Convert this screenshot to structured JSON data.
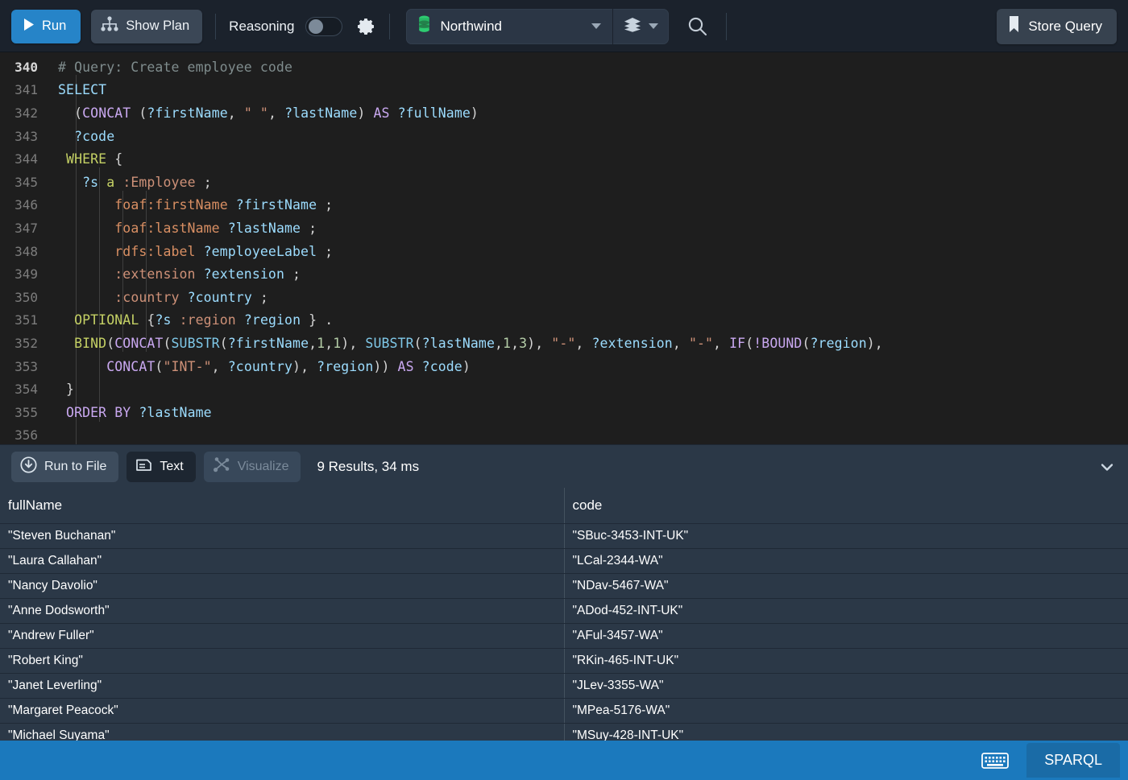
{
  "toolbar": {
    "run_label": "Run",
    "show_plan_label": "Show Plan",
    "reasoning_label": "Reasoning",
    "reasoning_enabled": false,
    "database_name": "Northwind",
    "store_query_label": "Store Query",
    "icons": {
      "run": "play-icon",
      "show_plan": "plan-tree-icon",
      "settings": "gear-icon",
      "database": "database-cylinder-icon",
      "layers": "layers-icon",
      "search": "search-icon",
      "store_query": "bookmark-icon"
    },
    "accent_color": "#2684c8"
  },
  "editor": {
    "language": "SPARQL",
    "first_line_number": 340,
    "lines": [
      {
        "n": "340",
        "current": true
      },
      {
        "n": "341"
      },
      {
        "n": "342"
      },
      {
        "n": "343"
      },
      {
        "n": "344"
      },
      {
        "n": "345"
      },
      {
        "n": "346"
      },
      {
        "n": "347"
      },
      {
        "n": "348"
      },
      {
        "n": "349"
      },
      {
        "n": "350"
      },
      {
        "n": "351"
      },
      {
        "n": "352"
      },
      {
        "n": "353"
      },
      {
        "n": "354"
      },
      {
        "n": "355"
      },
      {
        "n": "356"
      }
    ],
    "source_text": [
      "# Query: Create employee code",
      "SELECT",
      "  (CONCAT (?firstName, \" \", ?lastName) AS ?fullName)",
      "  ?code",
      " WHERE {",
      "   ?s a :Employee ;",
      "       foaf:firstName ?firstName ;",
      "       foaf:lastName ?lastName ;",
      "       rdfs:label ?employeeLabel ;",
      "       :extension ?extension ;",
      "       :country ?country ;",
      "  OPTIONAL {?s :region ?region } .",
      "  BIND(CONCAT(SUBSTR(?firstName,1,1), SUBSTR(?lastName,1,3), \"-\", ?extension, \"-\", IF(!BOUND(?region),",
      "      CONCAT(\"INT-\", ?country), ?region)) AS ?code)",
      " }",
      " ORDER BY ?lastName",
      ""
    ]
  },
  "results": {
    "run_to_file_label": "Run to File",
    "text_tab_label": "Text",
    "visualize_tab_label": "Visualize",
    "active_tab": "Text",
    "visualize_disabled": true,
    "summary": "9 Results,  34 ms",
    "result_count": 9,
    "duration_ms": 34,
    "icons": {
      "run_to_file": "download-circle-icon",
      "text": "document-text-icon",
      "visualize": "graph-nodes-icon",
      "collapse": "chevron-down-icon"
    },
    "columns": [
      "fullName",
      "code"
    ],
    "rows": [
      [
        "\"Steven Buchanan\"",
        "\"SBuc-3453-INT-UK\""
      ],
      [
        "\"Laura Callahan\"",
        "\"LCal-2344-WA\""
      ],
      [
        "\"Nancy Davolio\"",
        "\"NDav-5467-WA\""
      ],
      [
        "\"Anne Dodsworth\"",
        "\"ADod-452-INT-UK\""
      ],
      [
        "\"Andrew Fuller\"",
        "\"AFul-3457-WA\""
      ],
      [
        "\"Robert King\"",
        "\"RKin-465-INT-UK\""
      ],
      [
        "\"Janet Leverling\"",
        "\"JLev-3355-WA\""
      ],
      [
        "\"Margaret Peacock\"",
        "\"MPea-5176-WA\""
      ],
      [
        "\"Michael Suyama\"",
        "\"MSuy-428-INT-UK\""
      ]
    ]
  },
  "statusbar": {
    "language_badge": "SPARQL",
    "keyboard_icon": "keyboard-icon",
    "background_color": "#1b79bd"
  }
}
